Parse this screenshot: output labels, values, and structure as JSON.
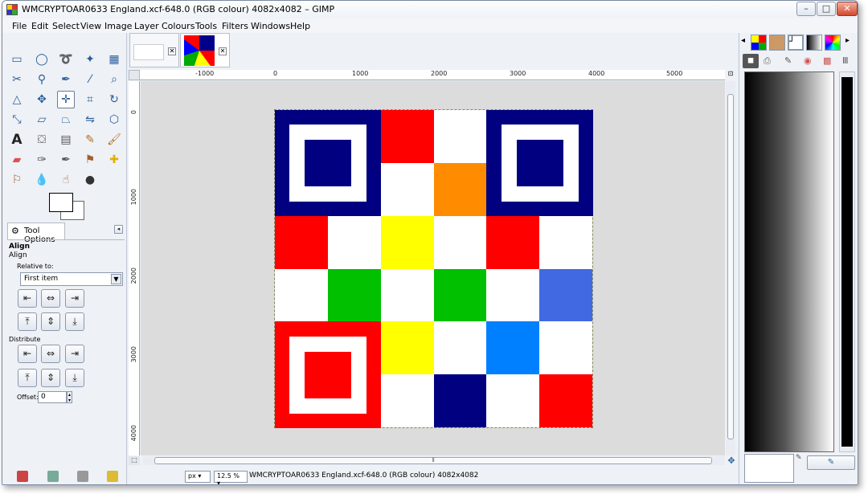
{
  "window": {
    "title": "WMCRYPTOAR0633 England.xcf-648.0 (RGB colour) 4082x4082 – GIMP",
    "minimize": "–",
    "maximize": "□",
    "close": "✕"
  },
  "menu": [
    "File",
    "Edit",
    "Select",
    "View",
    "Image",
    "Layer",
    "Colours",
    "Tools",
    "Filters",
    "Windows",
    "Help"
  ],
  "tools": [
    "rect-select",
    "ellipse-select",
    "free-select",
    "fuzzy-select",
    "by-color-select",
    "scissors-select",
    "foreground-select",
    "paths",
    "color-picker",
    "zoom",
    "measure",
    "move",
    "align",
    "crop",
    "rotate",
    "scale",
    "shear",
    "perspective",
    "flip",
    "cage-transform",
    "text",
    "bucket-fill",
    "blend",
    "pencil",
    "paintbrush",
    "eraser",
    "airbrush",
    "ink",
    "clone",
    "heal",
    "perspective-clone",
    "blur",
    "smudge",
    "dodge-burn"
  ],
  "tool_options": {
    "tab_label": "Tool Options",
    "heading": "Align",
    "subheading": "Align",
    "relative_to_label": "Relative to:",
    "relative_to_value": "First item",
    "distribute_label": "Distribute",
    "offset_label": "Offset:",
    "offset_value": "0"
  },
  "ruler_top": [
    "-1000",
    "0",
    "1000",
    "2000",
    "3000",
    "4000",
    "5000"
  ],
  "ruler_left": [
    "0",
    "1000",
    "2000",
    "3000",
    "4000"
  ],
  "qr_cells": [
    "#000080",
    "#000080",
    "#ff0000",
    "#ffffff",
    "#000080",
    "#000080",
    "#000080",
    "#000080",
    "#ffffff",
    "#ff8c00",
    "#000080",
    "#000080",
    "#ff0000",
    "#ffffff",
    "#ffff00",
    "#ffffff",
    "#ff0000",
    "#ffffff",
    "#ffffff",
    "#00c000",
    "#ffffff",
    "#00c000",
    "#ffffff",
    "#4169e1",
    "#ff0000",
    "#ff0000",
    "#ffff00",
    "#ffffff",
    "#0080ff",
    "#ffffff",
    "#ff0000",
    "#ff0000",
    "#ffffff",
    "#000080",
    "#ffffff",
    "#ff0000"
  ],
  "status": {
    "unit": "px",
    "zoom": "12.5 %",
    "text": "WMCRYPTOAR0633 England.xcf-648.0 (RGB colour) 4082x4082"
  }
}
